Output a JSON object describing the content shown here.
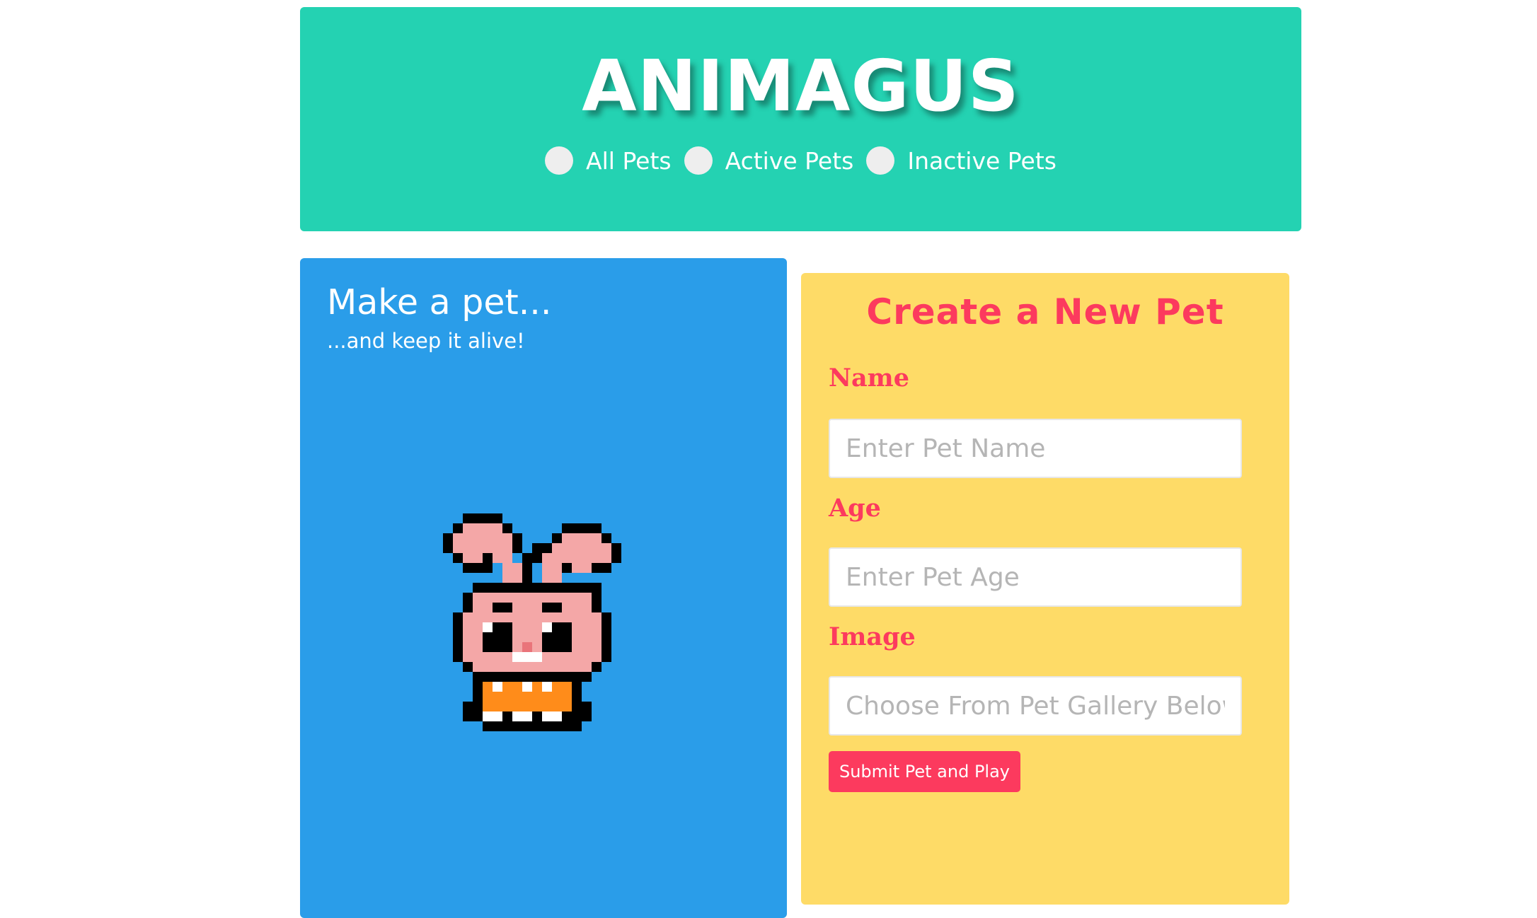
{
  "header": {
    "title": "ANIMAGUS",
    "filters": [
      {
        "label": "All Pets",
        "selected": false
      },
      {
        "label": "Active Pets",
        "selected": false
      },
      {
        "label": "Inactive Pets",
        "selected": false
      }
    ]
  },
  "intro": {
    "heading": "Make a pet...",
    "subheading": "...and keep it alive!"
  },
  "form": {
    "title": "Create a New Pet",
    "name_label": "Name",
    "name_placeholder": "Enter Pet Name",
    "name_value": "",
    "age_label": "Age",
    "age_placeholder": "Enter Pet Age",
    "age_value": "",
    "image_label": "Image",
    "image_placeholder": "Choose From Pet Gallery Below",
    "image_value": "",
    "submit_label": "Submit Pet and Play"
  },
  "colors": {
    "header_bg": "#24d2b2",
    "intro_bg": "#2a9de9",
    "form_bg": "#fedb67",
    "accent": "#fc3a5e"
  },
  "icons": {
    "pet_sprite": "pixel-bunny-icon"
  }
}
